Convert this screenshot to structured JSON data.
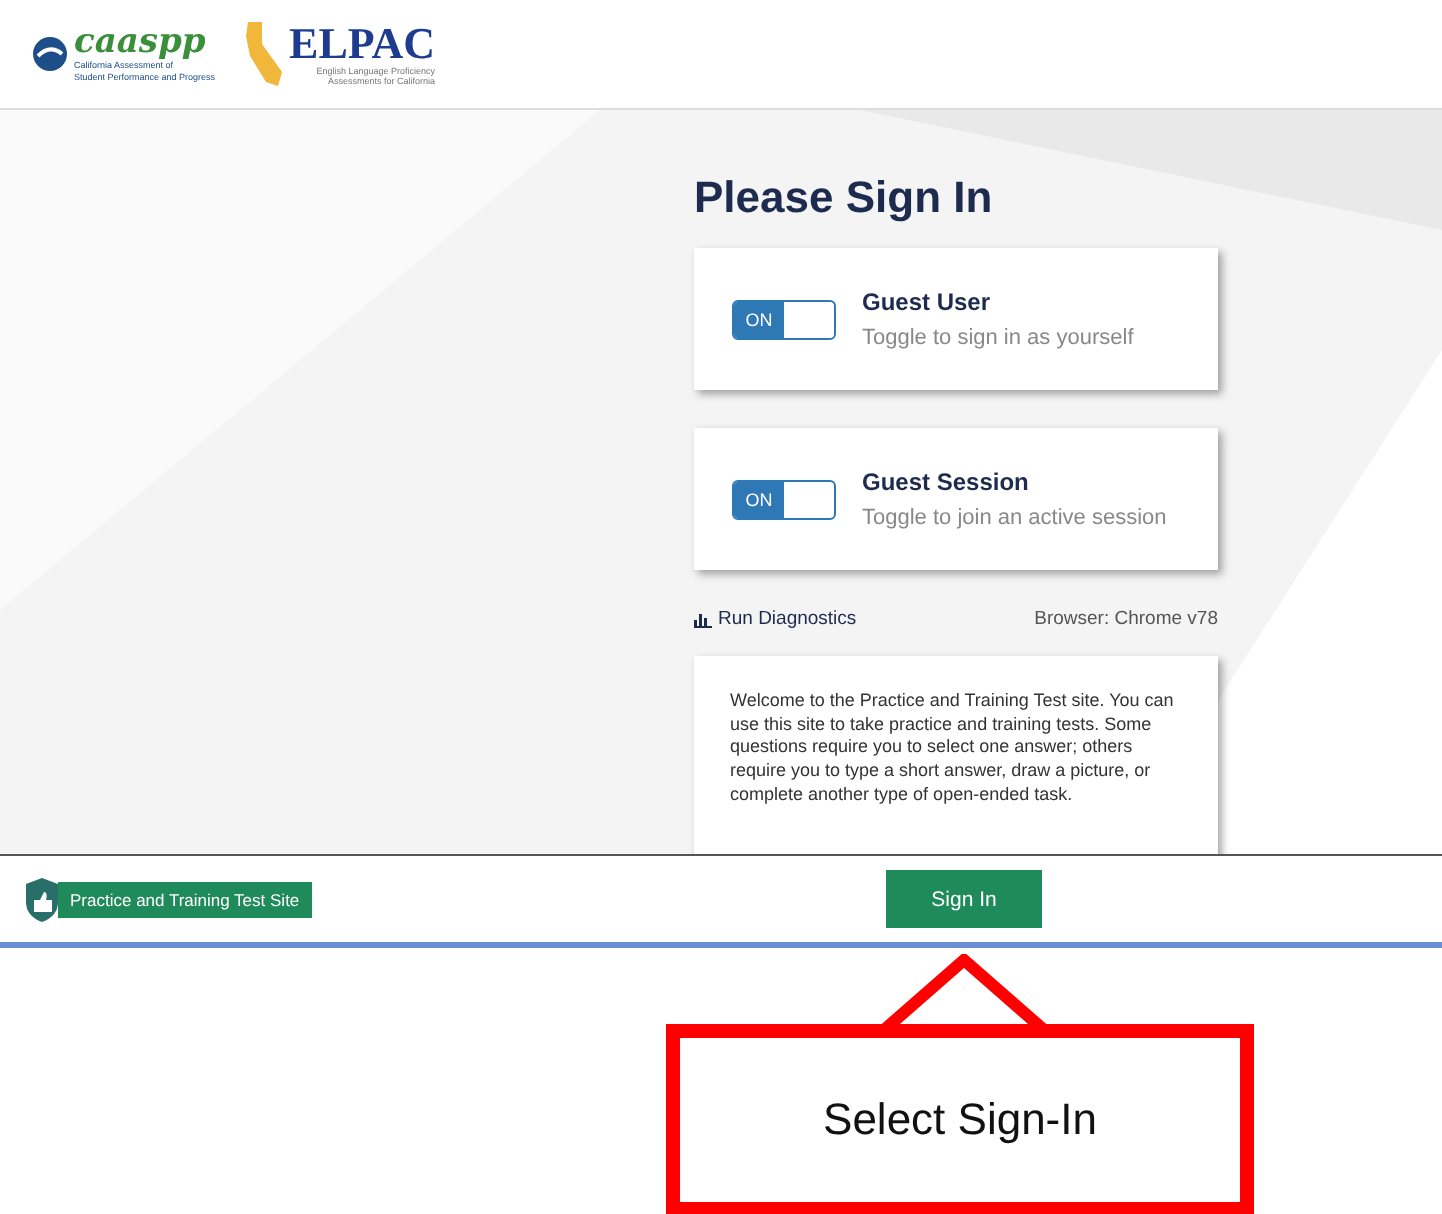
{
  "header": {
    "caaspp_logo": {
      "wordmark": "caaspp",
      "tagline": "California Assessment of\nStudent Performance and Progress"
    },
    "elpac_logo": {
      "wordmark": "ELPAC",
      "tagline": "English Language Proficiency\nAssessments for California"
    }
  },
  "title": "Please Sign In",
  "cards": [
    {
      "title": "Guest User",
      "subtitle": "Toggle to sign in as yourself",
      "toggle": {
        "label": "ON",
        "on": true
      }
    },
    {
      "title": "Guest Session",
      "subtitle": "Toggle to join an active session",
      "toggle": {
        "label": "ON",
        "on": true
      }
    }
  ],
  "diagnostics_link": "Run Diagnostics",
  "browser": "Browser: Chrome v78",
  "welcome": "Welcome to the Practice and Training Test site. You can use this site to take practice and training tests. Some questions require you to select one answer; others require you to type a short answer, draw a picture, or complete another type of open-ended task.",
  "footer": {
    "site_badge": "Practice and Training Test Site",
    "sign_in_button": "Sign In"
  },
  "callout": {
    "text": "Select Sign-In"
  }
}
